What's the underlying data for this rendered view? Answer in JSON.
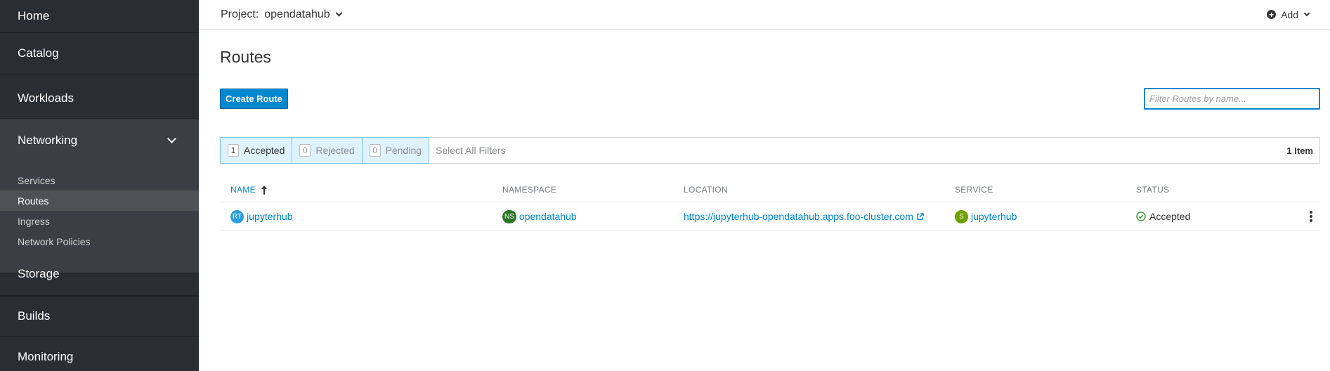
{
  "sidebar": {
    "items": [
      {
        "label": "Home"
      },
      {
        "label": "Catalog"
      },
      {
        "label": "Workloads"
      },
      {
        "label": "Networking",
        "expanded": true,
        "children": [
          {
            "label": "Services"
          },
          {
            "label": "Routes",
            "active": true
          },
          {
            "label": "Ingress"
          },
          {
            "label": "Network Policies"
          }
        ]
      },
      {
        "label": "Storage"
      },
      {
        "label": "Builds"
      },
      {
        "label": "Monitoring"
      }
    ]
  },
  "topbar": {
    "project_label": "Project:",
    "project_name": "opendatahub",
    "add_label": "Add",
    "add_icon": "plus-circle-icon"
  },
  "page": {
    "title": "Routes",
    "create_button": "Create Route",
    "filter_placeholder": "Filter Routes by name..."
  },
  "filters": {
    "chips": [
      {
        "count": "1",
        "label": "Accepted",
        "active": true
      },
      {
        "count": "0",
        "label": "Rejected",
        "active": false
      },
      {
        "count": "0",
        "label": "Pending",
        "active": false
      }
    ],
    "select_all": "Select All Filters",
    "item_count": "1 Item"
  },
  "table": {
    "columns": [
      "NAME",
      "NAMESPACE",
      "LOCATION",
      "SERVICE",
      "STATUS"
    ],
    "sorted_column": "NAME",
    "rows": [
      {
        "name_badge": "RT",
        "name": "jupyterhub",
        "namespace_badge": "NS",
        "namespace": "opendatahub",
        "location": "https://jupyterhub-opendatahub.apps.foo-cluster.com",
        "service_badge": "S",
        "service": "jupyterhub",
        "status": "Accepted"
      }
    ]
  },
  "colors": {
    "sidebar_bg": "#292e34",
    "accent": "#0088ce",
    "success": "#3f9c35"
  }
}
